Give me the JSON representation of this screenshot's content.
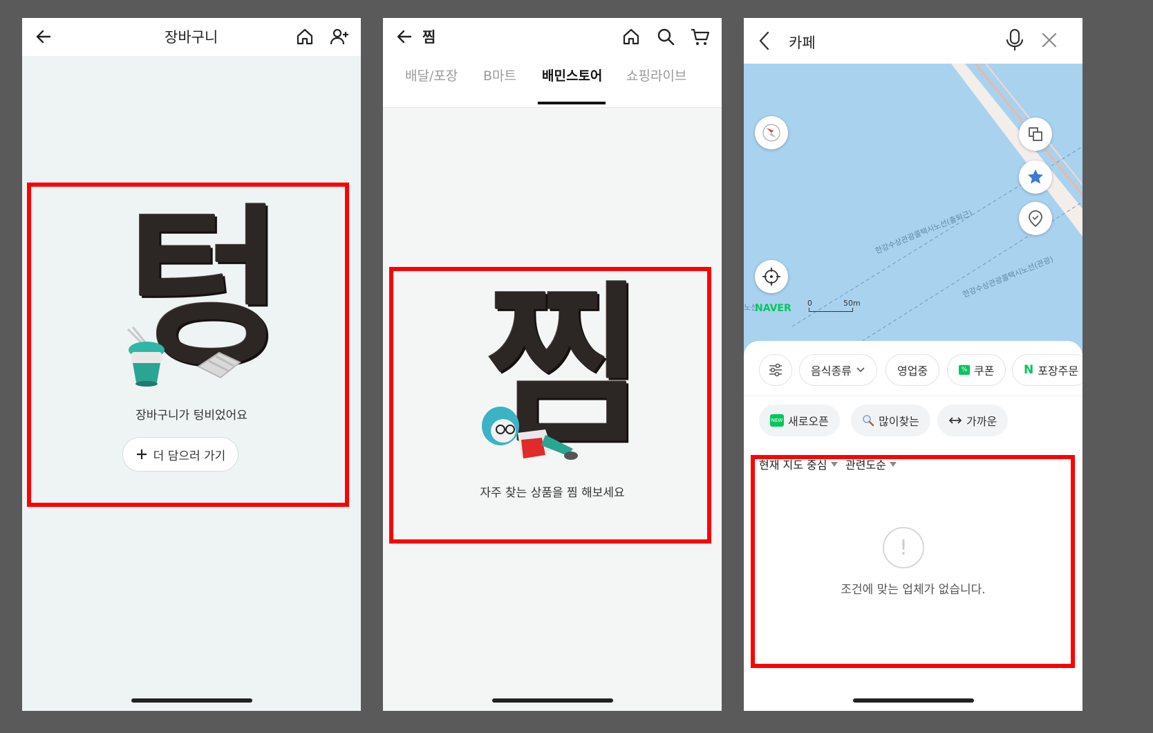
{
  "cart": {
    "title": "장바구니",
    "hero_text": "텅",
    "empty_message": "장바구니가 텅비었어요",
    "add_more_label": "더 담으러 가기"
  },
  "wishlist": {
    "title": "찜",
    "tabs": [
      {
        "label": "배달/포장",
        "active": false
      },
      {
        "label": "B마트",
        "active": false
      },
      {
        "label": "배민스토어",
        "active": true
      },
      {
        "label": "쇼핑라이브",
        "active": false
      }
    ],
    "hero_text": "찜",
    "empty_message": "자주 찾는 상품을 찜 해보세요"
  },
  "map": {
    "search_value": "카페",
    "brand": "NAVER",
    "scale_zero": "0",
    "scale_distance": "50m",
    "route_label_1": "한강수상관광콜택시노선(출퇴근)",
    "route_label_2": "한강수상관광콜택시노선(관광)",
    "route_label_edge": "노선",
    "filter_chips": [
      "음식종류",
      "영업중",
      "쿠폰",
      "포장주문"
    ],
    "quick_chips": [
      "새로오픈",
      "많이찾는",
      "가까운"
    ],
    "new_badge": "NEW",
    "coupon_badge": "%",
    "naver_badge": "N",
    "sort_location": "현재 지도 중심",
    "sort_order": "관련도순",
    "empty_message": "조건에 맞는 업체가 없습니다.",
    "empty_icon_glyph": "!"
  },
  "colors": {
    "highlight": "#ff0000",
    "naver_green": "#03c75a",
    "map_water": "#a9d2ef",
    "clay_dark": "#2c2624"
  }
}
